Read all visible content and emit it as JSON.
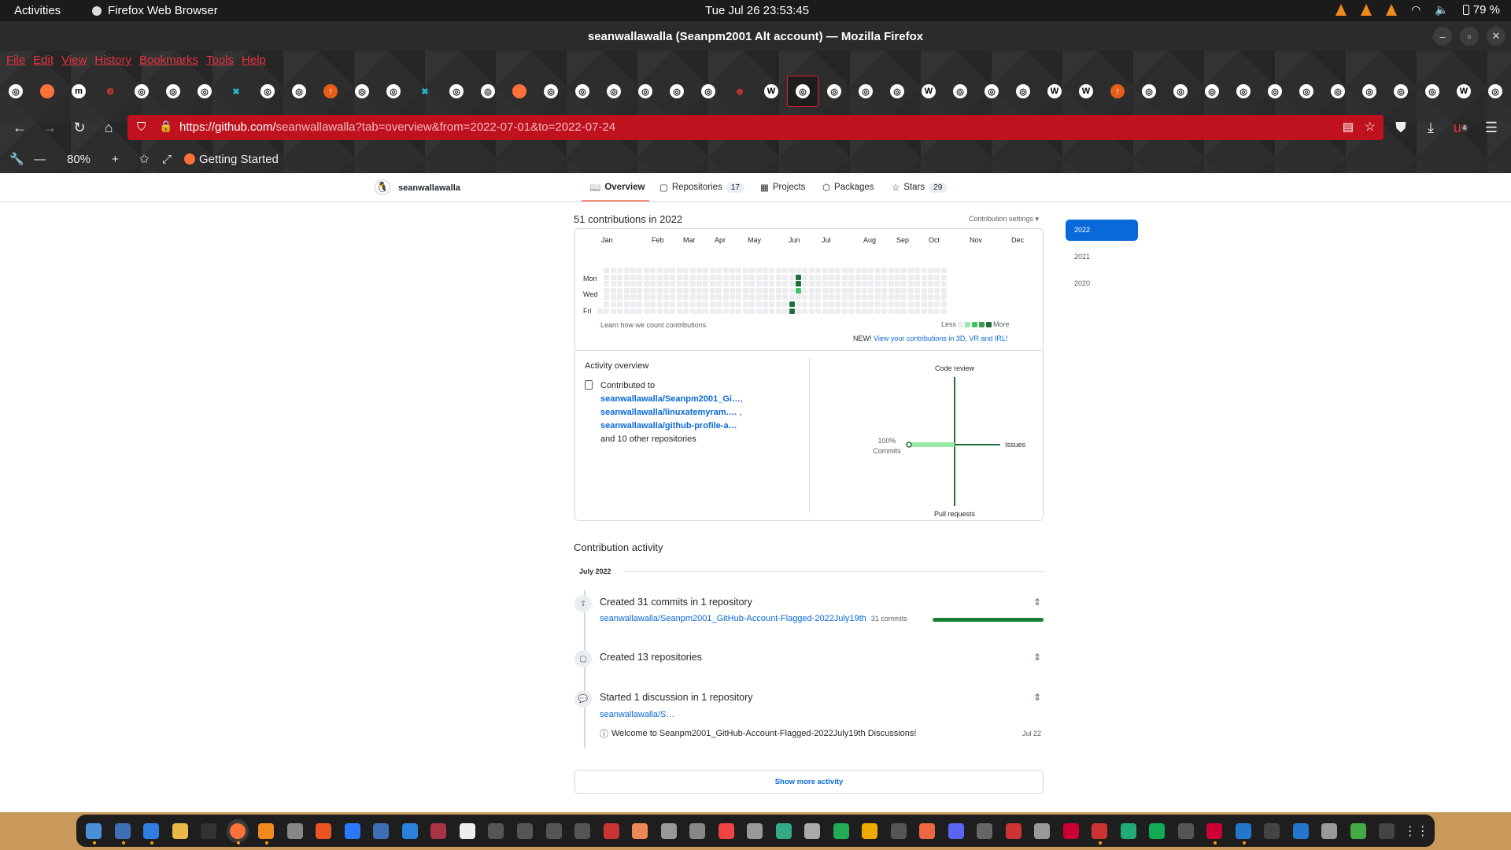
{
  "system": {
    "activities": "Activities",
    "app": "Firefox Web Browser",
    "clock": "Tue Jul 26  23:53:45",
    "battery": "79 %"
  },
  "window": {
    "title": "seanwallawalla (Seanpm2001 Alt account) — Mozilla Firefox"
  },
  "menu": [
    "File",
    "Edit",
    "View",
    "History",
    "Bookmarks",
    "Tools",
    "Help"
  ],
  "tabs": [
    {
      "icon": "github-icon"
    },
    {
      "icon": "firefox-icon"
    },
    {
      "icon": "m-icon"
    },
    {
      "icon": "settings-red-icon"
    },
    {
      "icon": "github-icon"
    },
    {
      "icon": "github-icon"
    },
    {
      "icon": "github-icon"
    },
    {
      "icon": "cyan-x-icon"
    },
    {
      "icon": "github-icon"
    },
    {
      "icon": "github-icon"
    },
    {
      "icon": "orange-circle-icon"
    },
    {
      "icon": "github-icon"
    },
    {
      "icon": "github-icon"
    },
    {
      "icon": "cyan-x-icon"
    },
    {
      "icon": "github-icon"
    },
    {
      "icon": "github-icon"
    },
    {
      "icon": "firefox-icon"
    },
    {
      "icon": "github-icon"
    },
    {
      "icon": "github-icon"
    },
    {
      "icon": "github-icon"
    },
    {
      "icon": "github-icon"
    },
    {
      "icon": "github-icon"
    },
    {
      "icon": "github-icon"
    },
    {
      "icon": "globe-red-icon"
    },
    {
      "icon": "wikipedia-icon"
    },
    {
      "icon": "github-icon",
      "active": true
    },
    {
      "icon": "github-icon"
    },
    {
      "icon": "github-icon"
    },
    {
      "icon": "github-icon"
    },
    {
      "icon": "wikipedia-icon"
    },
    {
      "icon": "github-icon"
    },
    {
      "icon": "github-icon"
    },
    {
      "icon": "github-icon"
    },
    {
      "icon": "wikipedia-icon"
    },
    {
      "icon": "wikipedia-icon"
    },
    {
      "icon": "orange-circle-icon"
    },
    {
      "icon": "github-icon"
    },
    {
      "icon": "github-icon"
    },
    {
      "icon": "github-icon"
    },
    {
      "icon": "github-icon"
    },
    {
      "icon": "github-icon"
    },
    {
      "icon": "github-icon"
    },
    {
      "icon": "github-icon"
    },
    {
      "icon": "github-icon"
    },
    {
      "icon": "github-icon"
    },
    {
      "icon": "github-icon"
    },
    {
      "icon": "wikipedia-icon"
    },
    {
      "icon": "github-icon"
    }
  ],
  "url": {
    "host": "https://github.com/",
    "path": "seanwallawalla?tab=overview&from=2022-07-01&to=2022-07-24"
  },
  "toolbar": {
    "zoom": "80%",
    "bookmark": "Getting Started",
    "ext_badge": "4"
  },
  "profile": {
    "username": "seanwallawalla",
    "tabs": [
      {
        "label": "Overview"
      },
      {
        "label": "Repositories",
        "count": "17"
      },
      {
        "label": "Projects"
      },
      {
        "label": "Packages"
      },
      {
        "label": "Stars",
        "count": "29"
      }
    ]
  },
  "contrib": {
    "title": "51 contributions in 2022",
    "settings": "Contribution settings ▾",
    "months": [
      "Jan",
      "Feb",
      "Mar",
      "Apr",
      "May",
      "Jun",
      "Jul",
      "Aug",
      "Sep",
      "Oct",
      "Nov",
      "Dec"
    ],
    "days": [
      "Mon",
      "Wed",
      "Fri"
    ],
    "learn": "Learn how we count contributions",
    "less": "Less",
    "more": "More",
    "new_label": "NEW!",
    "new_link": "View your contributions in 3D, VR and IRL!",
    "active_cells": [
      {
        "week": 29,
        "day": 5,
        "level": 4
      },
      {
        "week": 29,
        "day": 6,
        "level": 4
      },
      {
        "week": 29,
        "day": 7,
        "level": 4
      },
      {
        "week": 30,
        "day": 1,
        "level": 4
      },
      {
        "week": 30,
        "day": 2,
        "level": 4
      },
      {
        "week": 30,
        "day": 3,
        "level": 2
      }
    ]
  },
  "overview": {
    "title": "Activity overview",
    "contributed_to": "Contributed to",
    "repos": [
      "seanwallawalla/Seanpm2001_Gi…",
      "seanwallawalla/linuxatemyram.…",
      "seanwallawalla/github-profile-a…"
    ],
    "others": "and 10 other repositories",
    "axes": {
      "top": "Code review",
      "right": "Issues",
      "bottom": "Pull requests",
      "left_pct": "100%",
      "left": "Commits"
    }
  },
  "years": [
    "2022",
    "2021",
    "2020"
  ],
  "activity": {
    "title": "Contribution activity",
    "month": "July 2022",
    "commits_title": "Created 31 commits in 1 repository",
    "commits_repo": "seanwallawalla/Seanpm2001_GitHub-Account-Flagged-2022July19th",
    "commits_count": "31 commits",
    "repos_title": "Created 13 repositories",
    "disc_title": "Started 1 discussion in 1 repository",
    "disc_repo": "seanwallawalla/S…",
    "disc_item": "Welcome to Seanpm2001_GitHub-Account-Flagged-2022July19th Discussions!",
    "disc_date": "Jul 22",
    "show_more": "Show more activity"
  },
  "colors": {
    "level0": "#ebedf0",
    "level1": "#9be9a8",
    "level2": "#40c463",
    "level3": "#30a14e",
    "level4": "#216e39",
    "accent": "#0969da"
  },
  "dock": [
    "#4a90d9",
    "#3d6fb6",
    "#2f7de1",
    "#e8b84a",
    "#333",
    "#ff7139",
    "#f08a1c",
    "#888",
    "#e95420",
    "#2979ff",
    "#3d6fb6",
    "#2a82da",
    "#a34",
    "#eee",
    "#555",
    "#555",
    "#555",
    "#555",
    "#c33",
    "#e85",
    "#999",
    "#888",
    "#e44",
    "#999",
    "#3a8",
    "#aaa",
    "#2a5",
    "#ea0",
    "#555",
    "#e64",
    "#5865f2",
    "#666",
    "#c33",
    "#999",
    "#c03",
    "#c33",
    "#2a7",
    "#1a5",
    "#555",
    "#c03",
    "#27c",
    "#444",
    "#27c",
    "#999",
    "#4a4",
    "#444"
  ]
}
